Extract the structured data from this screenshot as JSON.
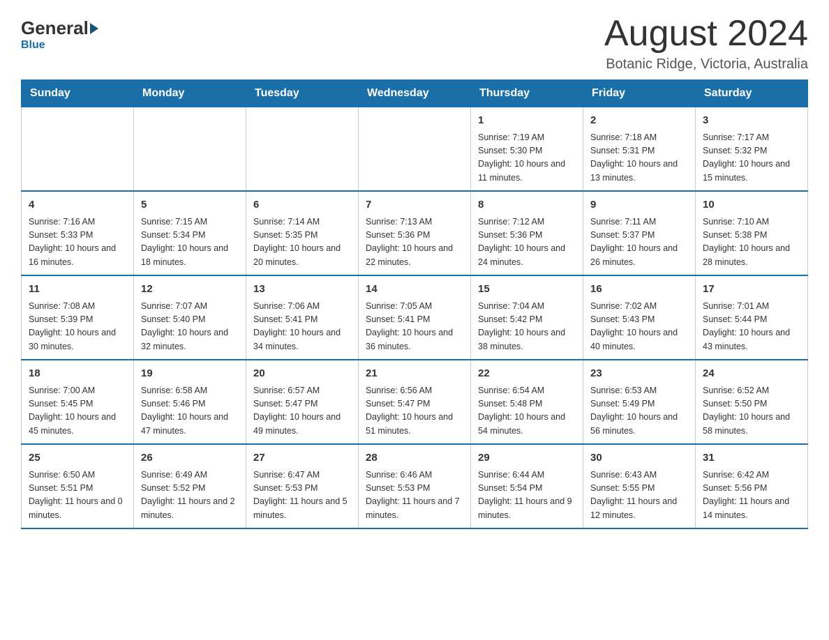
{
  "logo": {
    "general": "General",
    "blue": "Blue"
  },
  "header": {
    "month_year": "August 2024",
    "location": "Botanic Ridge, Victoria, Australia"
  },
  "weekdays": [
    "Sunday",
    "Monday",
    "Tuesday",
    "Wednesday",
    "Thursday",
    "Friday",
    "Saturday"
  ],
  "weeks": [
    [
      {
        "day": "",
        "info": ""
      },
      {
        "day": "",
        "info": ""
      },
      {
        "day": "",
        "info": ""
      },
      {
        "day": "",
        "info": ""
      },
      {
        "day": "1",
        "info": "Sunrise: 7:19 AM\nSunset: 5:30 PM\nDaylight: 10 hours and 11 minutes."
      },
      {
        "day": "2",
        "info": "Sunrise: 7:18 AM\nSunset: 5:31 PM\nDaylight: 10 hours and 13 minutes."
      },
      {
        "day": "3",
        "info": "Sunrise: 7:17 AM\nSunset: 5:32 PM\nDaylight: 10 hours and 15 minutes."
      }
    ],
    [
      {
        "day": "4",
        "info": "Sunrise: 7:16 AM\nSunset: 5:33 PM\nDaylight: 10 hours and 16 minutes."
      },
      {
        "day": "5",
        "info": "Sunrise: 7:15 AM\nSunset: 5:34 PM\nDaylight: 10 hours and 18 minutes."
      },
      {
        "day": "6",
        "info": "Sunrise: 7:14 AM\nSunset: 5:35 PM\nDaylight: 10 hours and 20 minutes."
      },
      {
        "day": "7",
        "info": "Sunrise: 7:13 AM\nSunset: 5:36 PM\nDaylight: 10 hours and 22 minutes."
      },
      {
        "day": "8",
        "info": "Sunrise: 7:12 AM\nSunset: 5:36 PM\nDaylight: 10 hours and 24 minutes."
      },
      {
        "day": "9",
        "info": "Sunrise: 7:11 AM\nSunset: 5:37 PM\nDaylight: 10 hours and 26 minutes."
      },
      {
        "day": "10",
        "info": "Sunrise: 7:10 AM\nSunset: 5:38 PM\nDaylight: 10 hours and 28 minutes."
      }
    ],
    [
      {
        "day": "11",
        "info": "Sunrise: 7:08 AM\nSunset: 5:39 PM\nDaylight: 10 hours and 30 minutes."
      },
      {
        "day": "12",
        "info": "Sunrise: 7:07 AM\nSunset: 5:40 PM\nDaylight: 10 hours and 32 minutes."
      },
      {
        "day": "13",
        "info": "Sunrise: 7:06 AM\nSunset: 5:41 PM\nDaylight: 10 hours and 34 minutes."
      },
      {
        "day": "14",
        "info": "Sunrise: 7:05 AM\nSunset: 5:41 PM\nDaylight: 10 hours and 36 minutes."
      },
      {
        "day": "15",
        "info": "Sunrise: 7:04 AM\nSunset: 5:42 PM\nDaylight: 10 hours and 38 minutes."
      },
      {
        "day": "16",
        "info": "Sunrise: 7:02 AM\nSunset: 5:43 PM\nDaylight: 10 hours and 40 minutes."
      },
      {
        "day": "17",
        "info": "Sunrise: 7:01 AM\nSunset: 5:44 PM\nDaylight: 10 hours and 43 minutes."
      }
    ],
    [
      {
        "day": "18",
        "info": "Sunrise: 7:00 AM\nSunset: 5:45 PM\nDaylight: 10 hours and 45 minutes."
      },
      {
        "day": "19",
        "info": "Sunrise: 6:58 AM\nSunset: 5:46 PM\nDaylight: 10 hours and 47 minutes."
      },
      {
        "day": "20",
        "info": "Sunrise: 6:57 AM\nSunset: 5:47 PM\nDaylight: 10 hours and 49 minutes."
      },
      {
        "day": "21",
        "info": "Sunrise: 6:56 AM\nSunset: 5:47 PM\nDaylight: 10 hours and 51 minutes."
      },
      {
        "day": "22",
        "info": "Sunrise: 6:54 AM\nSunset: 5:48 PM\nDaylight: 10 hours and 54 minutes."
      },
      {
        "day": "23",
        "info": "Sunrise: 6:53 AM\nSunset: 5:49 PM\nDaylight: 10 hours and 56 minutes."
      },
      {
        "day": "24",
        "info": "Sunrise: 6:52 AM\nSunset: 5:50 PM\nDaylight: 10 hours and 58 minutes."
      }
    ],
    [
      {
        "day": "25",
        "info": "Sunrise: 6:50 AM\nSunset: 5:51 PM\nDaylight: 11 hours and 0 minutes."
      },
      {
        "day": "26",
        "info": "Sunrise: 6:49 AM\nSunset: 5:52 PM\nDaylight: 11 hours and 2 minutes."
      },
      {
        "day": "27",
        "info": "Sunrise: 6:47 AM\nSunset: 5:53 PM\nDaylight: 11 hours and 5 minutes."
      },
      {
        "day": "28",
        "info": "Sunrise: 6:46 AM\nSunset: 5:53 PM\nDaylight: 11 hours and 7 minutes."
      },
      {
        "day": "29",
        "info": "Sunrise: 6:44 AM\nSunset: 5:54 PM\nDaylight: 11 hours and 9 minutes."
      },
      {
        "day": "30",
        "info": "Sunrise: 6:43 AM\nSunset: 5:55 PM\nDaylight: 11 hours and 12 minutes."
      },
      {
        "day": "31",
        "info": "Sunrise: 6:42 AM\nSunset: 5:56 PM\nDaylight: 11 hours and 14 minutes."
      }
    ]
  ]
}
